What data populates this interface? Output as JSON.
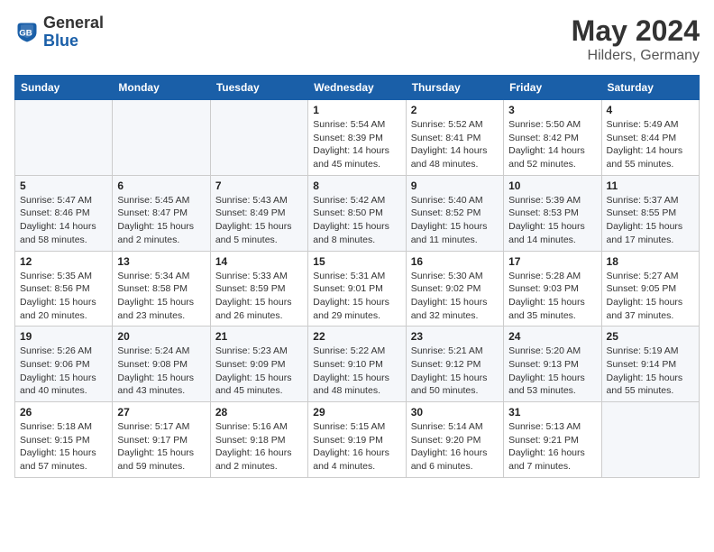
{
  "header": {
    "logo_general": "General",
    "logo_blue": "Blue",
    "title": "May 2024",
    "location": "Hilders, Germany"
  },
  "weekdays": [
    "Sunday",
    "Monday",
    "Tuesday",
    "Wednesday",
    "Thursday",
    "Friday",
    "Saturday"
  ],
  "weeks": [
    {
      "days": [
        {
          "num": "",
          "info": ""
        },
        {
          "num": "",
          "info": ""
        },
        {
          "num": "",
          "info": ""
        },
        {
          "num": "1",
          "info": "Sunrise: 5:54 AM\nSunset: 8:39 PM\nDaylight: 14 hours\nand 45 minutes."
        },
        {
          "num": "2",
          "info": "Sunrise: 5:52 AM\nSunset: 8:41 PM\nDaylight: 14 hours\nand 48 minutes."
        },
        {
          "num": "3",
          "info": "Sunrise: 5:50 AM\nSunset: 8:42 PM\nDaylight: 14 hours\nand 52 minutes."
        },
        {
          "num": "4",
          "info": "Sunrise: 5:49 AM\nSunset: 8:44 PM\nDaylight: 14 hours\nand 55 minutes."
        }
      ]
    },
    {
      "days": [
        {
          "num": "5",
          "info": "Sunrise: 5:47 AM\nSunset: 8:46 PM\nDaylight: 14 hours\nand 58 minutes."
        },
        {
          "num": "6",
          "info": "Sunrise: 5:45 AM\nSunset: 8:47 PM\nDaylight: 15 hours\nand 2 minutes."
        },
        {
          "num": "7",
          "info": "Sunrise: 5:43 AM\nSunset: 8:49 PM\nDaylight: 15 hours\nand 5 minutes."
        },
        {
          "num": "8",
          "info": "Sunrise: 5:42 AM\nSunset: 8:50 PM\nDaylight: 15 hours\nand 8 minutes."
        },
        {
          "num": "9",
          "info": "Sunrise: 5:40 AM\nSunset: 8:52 PM\nDaylight: 15 hours\nand 11 minutes."
        },
        {
          "num": "10",
          "info": "Sunrise: 5:39 AM\nSunset: 8:53 PM\nDaylight: 15 hours\nand 14 minutes."
        },
        {
          "num": "11",
          "info": "Sunrise: 5:37 AM\nSunset: 8:55 PM\nDaylight: 15 hours\nand 17 minutes."
        }
      ]
    },
    {
      "days": [
        {
          "num": "12",
          "info": "Sunrise: 5:35 AM\nSunset: 8:56 PM\nDaylight: 15 hours\nand 20 minutes."
        },
        {
          "num": "13",
          "info": "Sunrise: 5:34 AM\nSunset: 8:58 PM\nDaylight: 15 hours\nand 23 minutes."
        },
        {
          "num": "14",
          "info": "Sunrise: 5:33 AM\nSunset: 8:59 PM\nDaylight: 15 hours\nand 26 minutes."
        },
        {
          "num": "15",
          "info": "Sunrise: 5:31 AM\nSunset: 9:01 PM\nDaylight: 15 hours\nand 29 minutes."
        },
        {
          "num": "16",
          "info": "Sunrise: 5:30 AM\nSunset: 9:02 PM\nDaylight: 15 hours\nand 32 minutes."
        },
        {
          "num": "17",
          "info": "Sunrise: 5:28 AM\nSunset: 9:03 PM\nDaylight: 15 hours\nand 35 minutes."
        },
        {
          "num": "18",
          "info": "Sunrise: 5:27 AM\nSunset: 9:05 PM\nDaylight: 15 hours\nand 37 minutes."
        }
      ]
    },
    {
      "days": [
        {
          "num": "19",
          "info": "Sunrise: 5:26 AM\nSunset: 9:06 PM\nDaylight: 15 hours\nand 40 minutes."
        },
        {
          "num": "20",
          "info": "Sunrise: 5:24 AM\nSunset: 9:08 PM\nDaylight: 15 hours\nand 43 minutes."
        },
        {
          "num": "21",
          "info": "Sunrise: 5:23 AM\nSunset: 9:09 PM\nDaylight: 15 hours\nand 45 minutes."
        },
        {
          "num": "22",
          "info": "Sunrise: 5:22 AM\nSunset: 9:10 PM\nDaylight: 15 hours\nand 48 minutes."
        },
        {
          "num": "23",
          "info": "Sunrise: 5:21 AM\nSunset: 9:12 PM\nDaylight: 15 hours\nand 50 minutes."
        },
        {
          "num": "24",
          "info": "Sunrise: 5:20 AM\nSunset: 9:13 PM\nDaylight: 15 hours\nand 53 minutes."
        },
        {
          "num": "25",
          "info": "Sunrise: 5:19 AM\nSunset: 9:14 PM\nDaylight: 15 hours\nand 55 minutes."
        }
      ]
    },
    {
      "days": [
        {
          "num": "26",
          "info": "Sunrise: 5:18 AM\nSunset: 9:15 PM\nDaylight: 15 hours\nand 57 minutes."
        },
        {
          "num": "27",
          "info": "Sunrise: 5:17 AM\nSunset: 9:17 PM\nDaylight: 15 hours\nand 59 minutes."
        },
        {
          "num": "28",
          "info": "Sunrise: 5:16 AM\nSunset: 9:18 PM\nDaylight: 16 hours\nand 2 minutes."
        },
        {
          "num": "29",
          "info": "Sunrise: 5:15 AM\nSunset: 9:19 PM\nDaylight: 16 hours\nand 4 minutes."
        },
        {
          "num": "30",
          "info": "Sunrise: 5:14 AM\nSunset: 9:20 PM\nDaylight: 16 hours\nand 6 minutes."
        },
        {
          "num": "31",
          "info": "Sunrise: 5:13 AM\nSunset: 9:21 PM\nDaylight: 16 hours\nand 7 minutes."
        },
        {
          "num": "",
          "info": ""
        }
      ]
    }
  ]
}
